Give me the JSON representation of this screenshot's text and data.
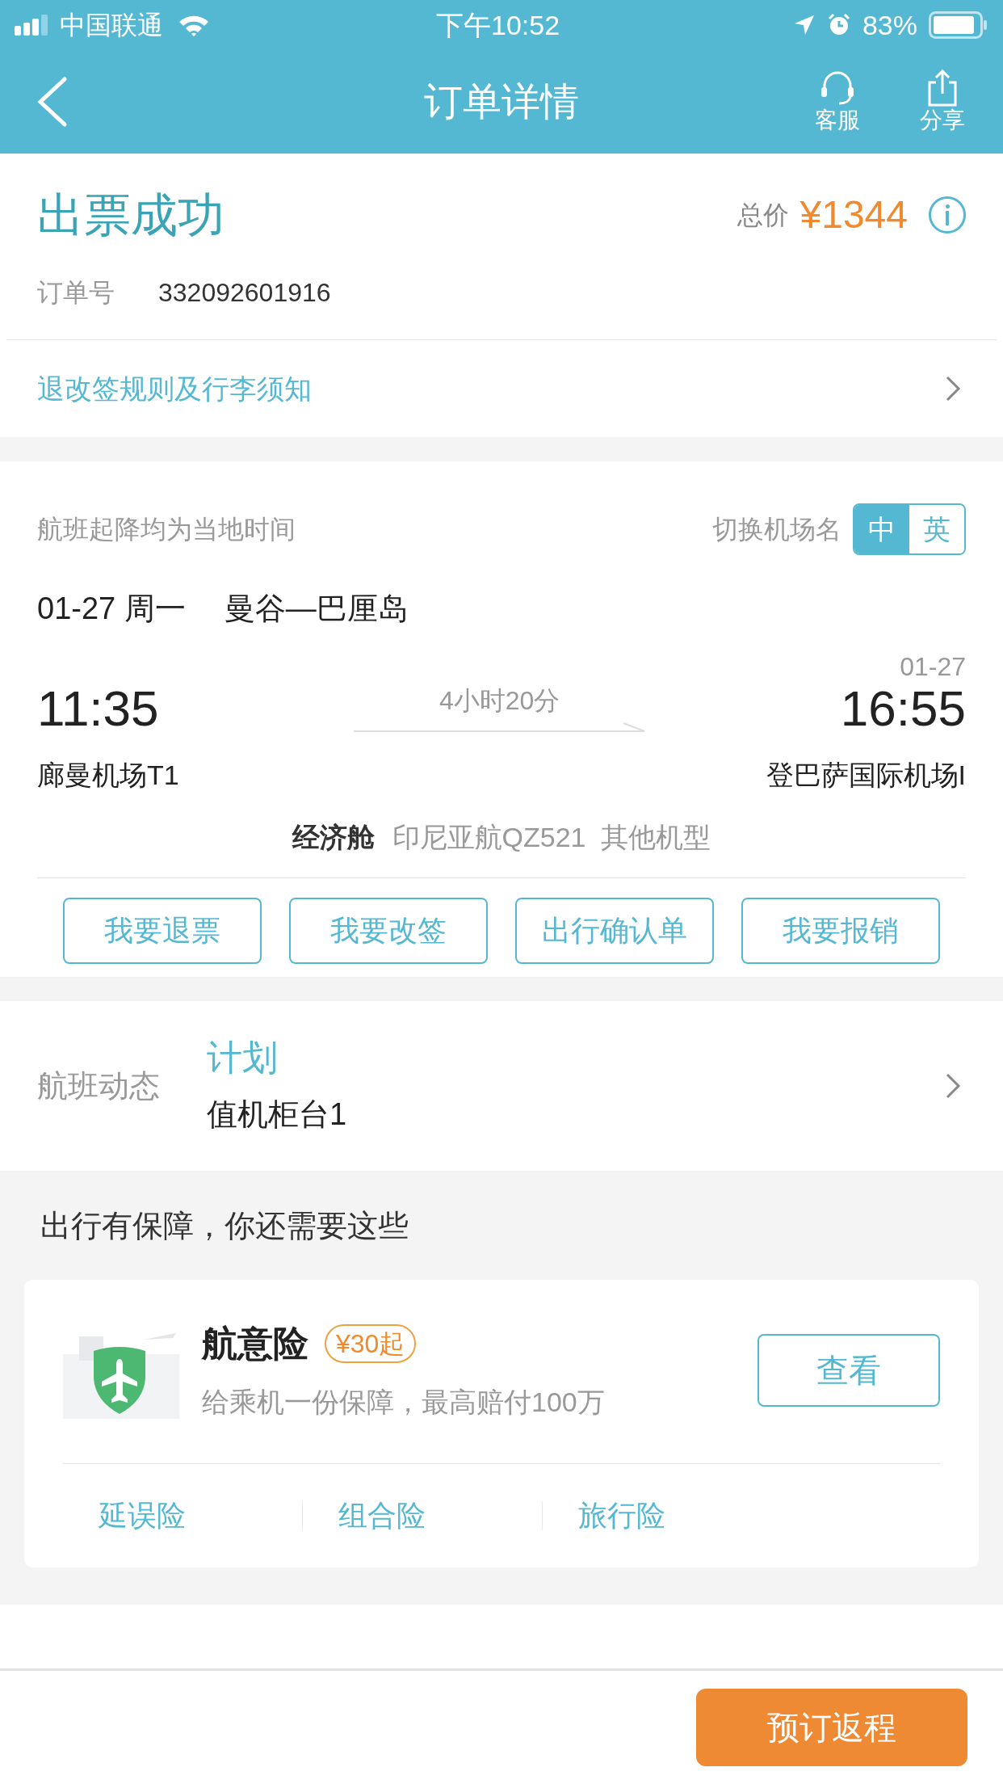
{
  "status_bar": {
    "carrier": "中国联通",
    "time": "下午10:52",
    "battery": "83%"
  },
  "nav": {
    "title": "订单详情",
    "actions": [
      {
        "label": "客服",
        "kind": "service"
      },
      {
        "label": "分享",
        "kind": "share"
      }
    ]
  },
  "order": {
    "status": "出票成功",
    "price_label": "总价",
    "price": "¥1344",
    "number_label": "订单号",
    "number": "332092601916",
    "rules_link": "退改签规则及行李须知"
  },
  "flight": {
    "note": "航班起降均为当地时间",
    "switch_label": "切换机场名",
    "lang_options": [
      {
        "label": "中",
        "selected": true
      },
      {
        "label": "英",
        "selected": false
      }
    ],
    "date": "01-27 周一",
    "route": "曼谷—巴厘岛",
    "dep_time": "11:35",
    "arr_date": "01-27",
    "arr_time": "16:55",
    "duration": "4小时20分",
    "dep_airport": "廊曼机场T1",
    "arr_airport": "登巴萨国际机场I",
    "cabin": "经济舱",
    "flight_info": "印尼亚航QZ521  其他机型",
    "buttons": [
      "我要退票",
      "我要改签",
      "出行确认单",
      "我要报销"
    ]
  },
  "flight_status": {
    "label": "航班动态",
    "status": "计划",
    "counter": "值机柜台1"
  },
  "insurance": {
    "heading": "出行有保障，你还需要这些",
    "title": "航意险",
    "price_tag": "¥30起",
    "desc": "给乘机一份保障，最高赔付100万",
    "view_button": "查看",
    "links": [
      "延误险",
      "组合险",
      "旅行险"
    ]
  },
  "bottom": {
    "button": "预订返程"
  }
}
